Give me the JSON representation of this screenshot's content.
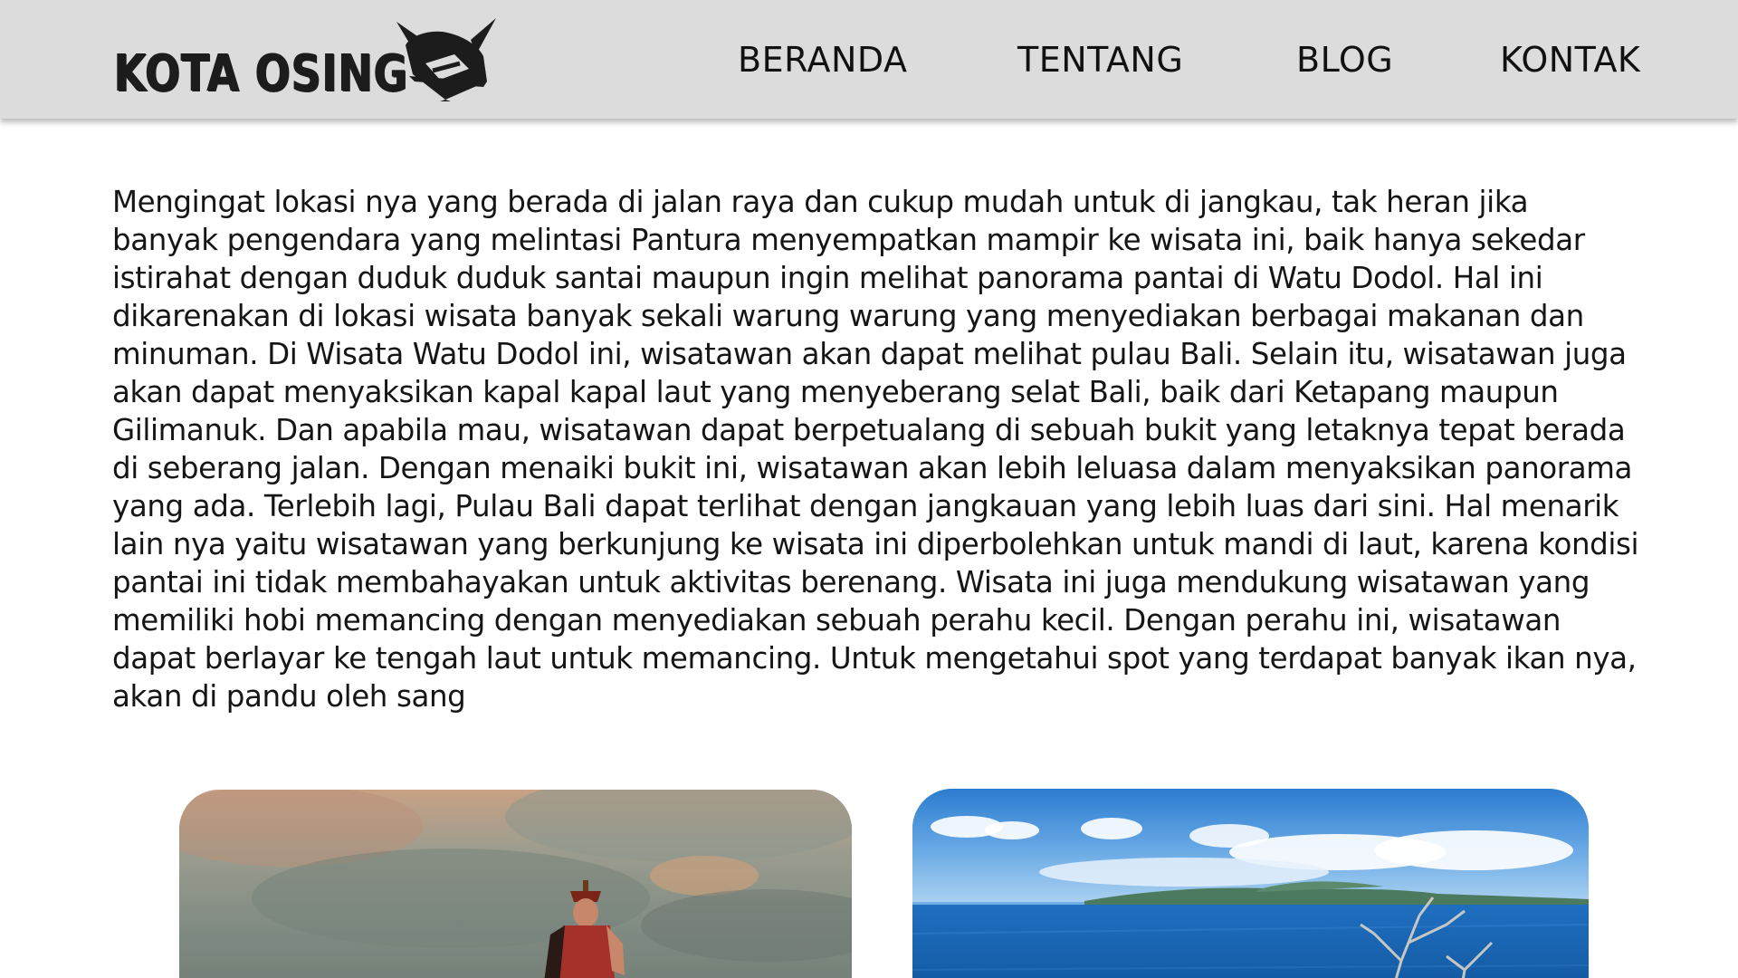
{
  "header": {
    "logo_text": "KOTA OSING",
    "logo_icon": "osing-headdress-icon",
    "nav": [
      {
        "label": "BERANDA"
      },
      {
        "label": "TENTANG"
      },
      {
        "label": "BLOG"
      },
      {
        "label": "KONTAK"
      }
    ]
  },
  "article": {
    "body": "Mengingat lokasi nya yang berada di jalan raya dan cukup mudah untuk di jangkau, tak heran jika banyak pengendara yang melintasi Pantura menyempatkan mampir ke wisata ini, baik hanya sekedar istirahat dengan duduk duduk santai maupun ingin melihat panorama pantai di Watu Dodol. Hal ini dikarenakan di lokasi wisata banyak sekali warung warung yang menyediakan berbagai makanan dan minuman. Di Wisata Watu Dodol ini, wisatawan akan dapat melihat pulau Bali. Selain itu, wisatawan juga akan dapat menyaksikan kapal kapal laut yang menyeberang selat Bali, baik dari Ketapang maupun Gilimanuk. Dan apabila mau, wisatawan dapat berpetualang di sebuah bukit yang letaknya tepat berada di seberang jalan. Dengan menaiki bukit ini, wisatawan akan lebih leluasa dalam menyaksikan panorama yang ada. Terlebih lagi, Pulau Bali dapat terlihat dengan jangkauan yang lebih luas dari sini. Hal menarik lain nya yaitu wisatawan yang berkunjung ke wisata ini diperbolehkan untuk mandi di laut, karena kondisi pantai ini tidak membahayakan untuk aktivitas berenang. Wisata ini juga mendukung wisatawan yang memiliki hobi memancing dengan menyediakan sebuah perahu kecil. Dengan perahu ini, wisatawan dapat berlayar ke tengah laut untuk memancing. Untuk mengetahui spot yang terdapat banyak ikan nya, akan di pandu oleh sang"
  },
  "gallery": {
    "images": [
      {
        "subject": "statue-under-cloudy-sky"
      },
      {
        "subject": "sea-and-bali-island-view"
      }
    ]
  },
  "colors": {
    "header_bg": "#dcdcdc",
    "text": "#151515",
    "page_bg": "#ffffff"
  }
}
